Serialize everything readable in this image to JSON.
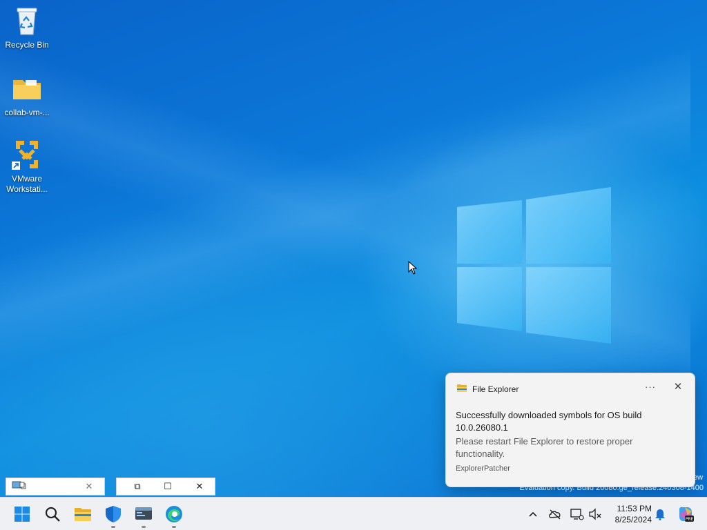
{
  "desktop": {
    "icons": [
      {
        "label": "Recycle Bin",
        "icon": "recycle-bin-icon"
      },
      {
        "label": "collab-vm-...",
        "icon": "folder-icon"
      },
      {
        "label_line1": "VMware",
        "label_line2": "Workstati...",
        "icon": "vmware-workstation-icon"
      }
    ],
    "watermark_line1": "ew",
    "watermark_line2": "Evaluation copy. Build 26080.ge_release.240308-1400"
  },
  "notification": {
    "app_name": "File Explorer",
    "app_icon": "file-explorer-icon",
    "more_label": "···",
    "close_label": "✕",
    "title": "Successfully downloaded symbols for OS build 10.0.26080.1",
    "body": "Please restart File Explorer to restore proper functionality.",
    "source": "ExplorerPatcher"
  },
  "minimized_windows": [
    {
      "icon": "app-window-icon",
      "close": "✕"
    },
    {
      "restore": "⧉",
      "maximize": "☐",
      "close": "✕"
    }
  ],
  "taskbar": {
    "pinned": [
      {
        "name": "start-button",
        "icon": "windows-start-icon"
      },
      {
        "name": "search-button",
        "icon": "search-icon"
      },
      {
        "name": "file-explorer",
        "icon": "folder-icon"
      },
      {
        "name": "windows-security",
        "icon": "shield-icon"
      },
      {
        "name": "terminal-app",
        "icon": "terminal-icon"
      },
      {
        "name": "edge-browser",
        "icon": "edge-icon"
      }
    ],
    "tray": {
      "chevron": "^",
      "time": "11:53 PM",
      "date": "8/25/2024"
    }
  },
  "colors": {
    "accent": "#0078d4",
    "taskbar_bg": "#eef0f3",
    "toast_bg": "#f3f3f3"
  }
}
